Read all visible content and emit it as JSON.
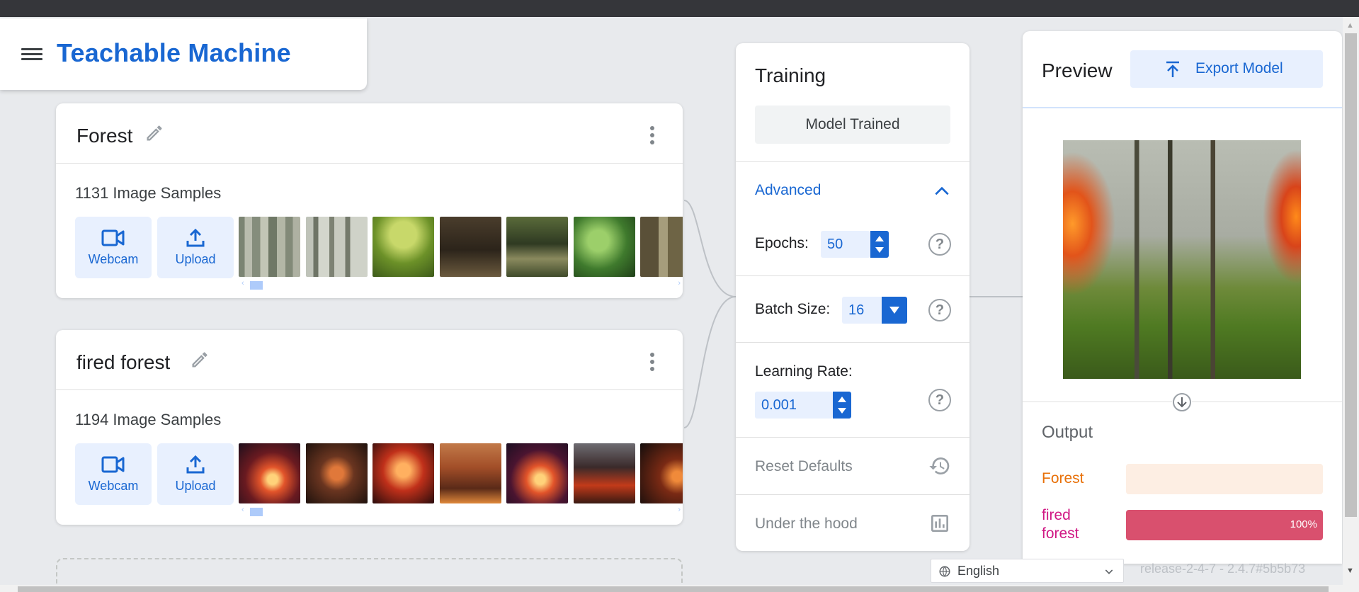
{
  "header": {
    "title": "Teachable Machine"
  },
  "classes": [
    {
      "name": "Forest",
      "sample_count": "1131 Image Samples",
      "webcam_label": "Webcam",
      "upload_label": "Upload",
      "thumb_colors": [
        "#9aa38f",
        "#a9aa9d",
        "#6f8f2a",
        "#3b3225",
        "#4a5a2e",
        "#3f7a2d",
        "#716a4e"
      ]
    },
    {
      "name": "fired forest",
      "sample_count": "1194 Image Samples",
      "webcam_label": "Webcam",
      "upload_label": "Upload",
      "thumb_colors": [
        "#2a1420",
        "#3a2116",
        "#6b1a12",
        "#8a4a2a",
        "#2b1726",
        "#57362d",
        "#1f1412"
      ]
    }
  ],
  "training": {
    "title": "Training",
    "status_button": "Model Trained",
    "advanced_label": "Advanced",
    "epochs_label": "Epochs:",
    "epochs_value": "50",
    "batch_label": "Batch Size:",
    "batch_value": "16",
    "lr_label": "Learning Rate:",
    "lr_value": "0.001",
    "reset_label": "Reset Defaults",
    "hood_label": "Under the hood"
  },
  "preview": {
    "title": "Preview",
    "export_label": "Export Model",
    "output_title": "Output",
    "outputs": [
      {
        "label": "Forest",
        "value": 0,
        "color": "#e8710a",
        "bar_bg": "#fdeee3"
      },
      {
        "label": "fired\nforest",
        "value": 100,
        "pct_text": "100%",
        "color": "#d01884",
        "bar_fill": "#d9506e"
      }
    ]
  },
  "footer": {
    "language": "English",
    "version": "release-2-4-7 - 2.4.7#5b5b73"
  }
}
